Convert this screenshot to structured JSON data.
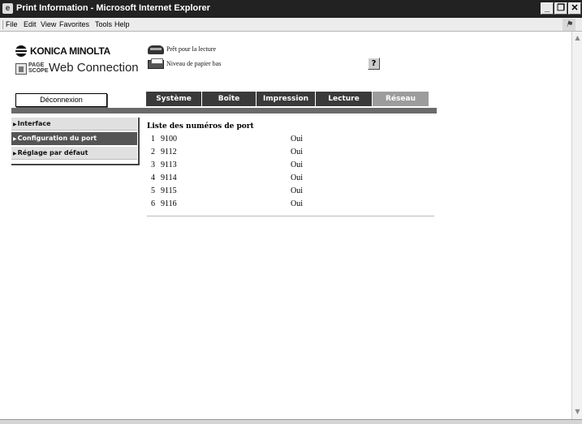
{
  "window": {
    "title": "Print Information - Microsoft Internet Explorer",
    "buttons": {
      "minimize": "_",
      "maximize": "❐",
      "close": "✕"
    }
  },
  "menu": [
    "File",
    "Edit",
    "View",
    "Favorites",
    "Tools",
    "Help"
  ],
  "logo": {
    "brand": "KONICA MINOLTA",
    "pagescope_line1": "PAGE",
    "pagescope_line2": "SCOPE",
    "product": "Web Connection"
  },
  "status": {
    "ready": "Prêt pour la lecture",
    "paper_low": "Niveau de papier bas"
  },
  "help_label": "?",
  "logout_label": "Déconnexion",
  "tabs": [
    {
      "label": "Système",
      "active": false
    },
    {
      "label": "Boîte",
      "active": false
    },
    {
      "label": "Impression",
      "active": false
    },
    {
      "label": "Lecture",
      "active": false
    },
    {
      "label": "Réseau",
      "active": true
    }
  ],
  "sidebar": [
    {
      "label": "Interface",
      "active": false
    },
    {
      "label": "Configuration du port",
      "active": true
    },
    {
      "label": "Réglage par défaut",
      "active": false
    }
  ],
  "port_list": {
    "title": "Liste des numéros de port",
    "rows": [
      {
        "num": "1",
        "port": "9100",
        "value": "Oui"
      },
      {
        "num": "2",
        "port": "9112",
        "value": "Oui"
      },
      {
        "num": "3",
        "port": "9113",
        "value": "Oui"
      },
      {
        "num": "4",
        "port": "9114",
        "value": "Oui"
      },
      {
        "num": "5",
        "port": "9115",
        "value": "Oui"
      },
      {
        "num": "6",
        "port": "9116",
        "value": "Oui"
      }
    ]
  },
  "colors": {
    "tab_inactive": "#3a3a3a",
    "tab_active": "#9c9c9c",
    "sidebar_active": "#555555"
  }
}
